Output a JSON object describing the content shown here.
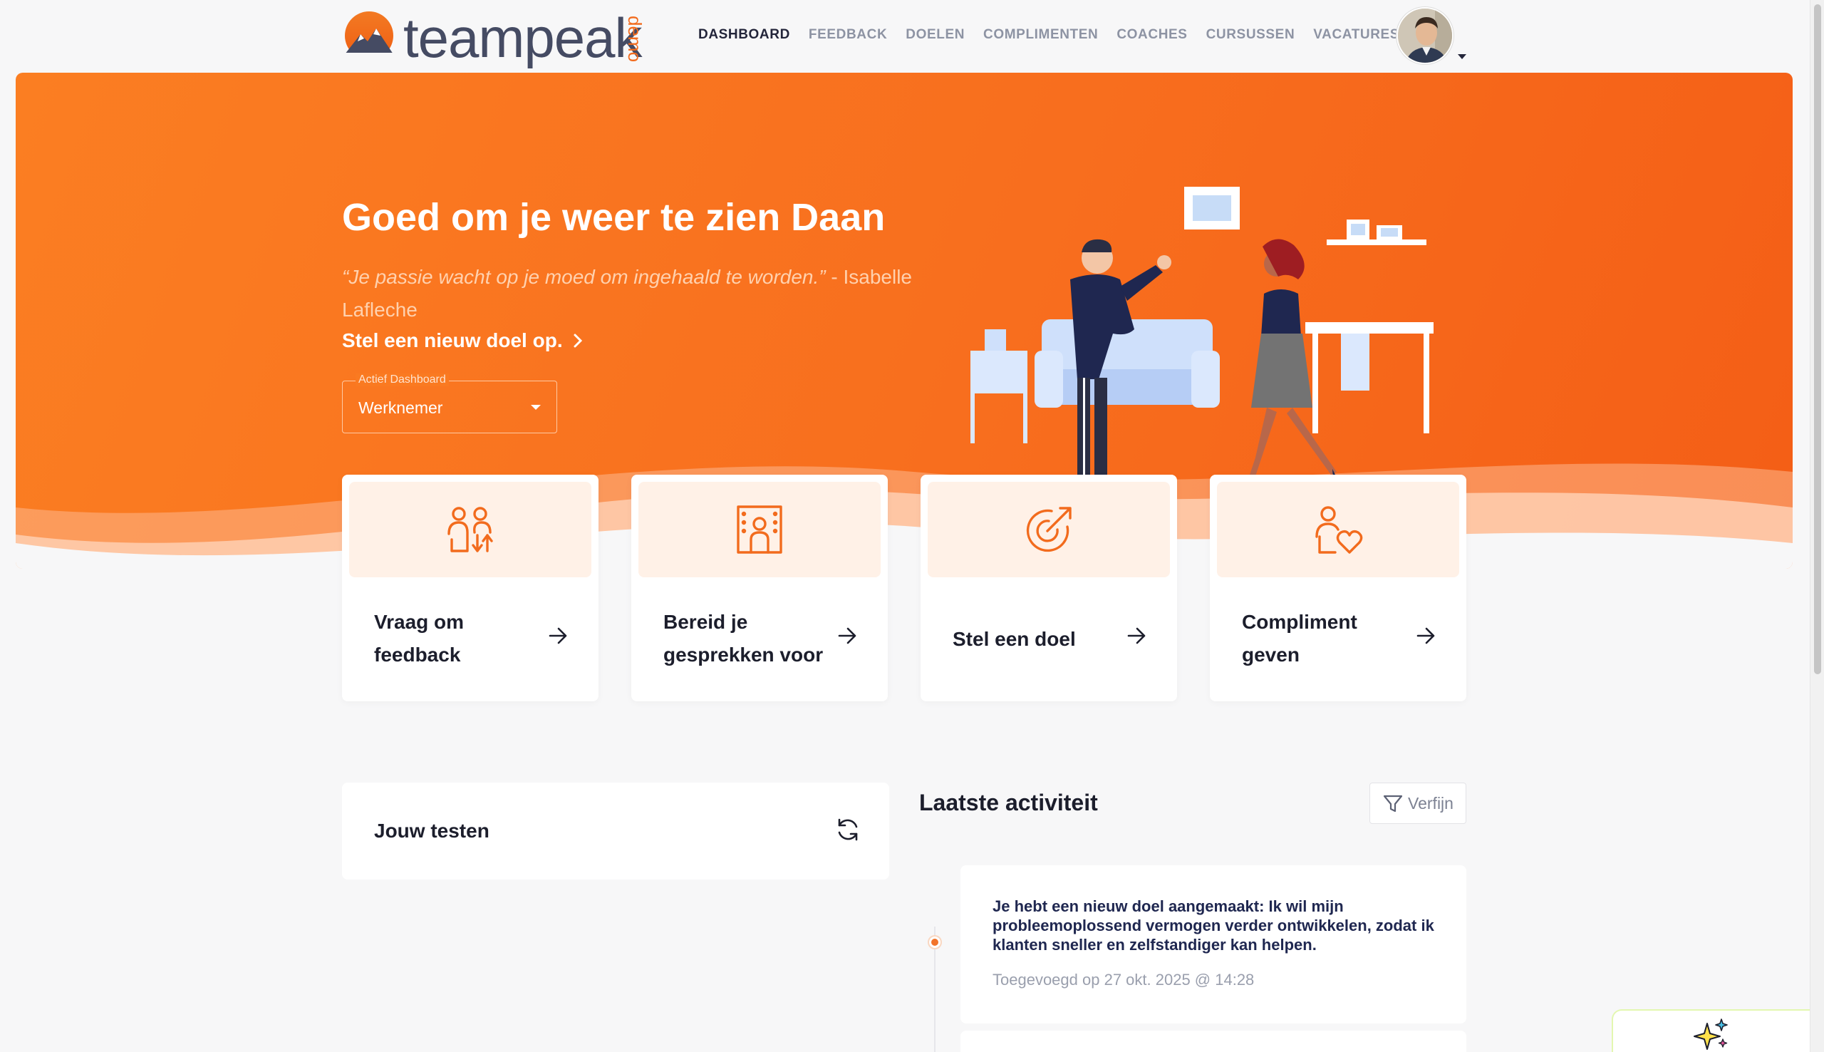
{
  "brand": {
    "name": "teampeak",
    "badge": "demo",
    "accent": "#f26b1d"
  },
  "nav": {
    "items": [
      {
        "label": "DASHBOARD",
        "active": true
      },
      {
        "label": "FEEDBACK",
        "active": false
      },
      {
        "label": "DOELEN",
        "active": false
      },
      {
        "label": "COMPLIMENTEN",
        "active": false
      },
      {
        "label": "COACHES",
        "active": false
      },
      {
        "label": "CURSUSSEN",
        "active": false
      },
      {
        "label": "VACATURES",
        "active": false
      }
    ]
  },
  "hero": {
    "title": "Goed om je weer te zien Daan",
    "quote": "“Je passie wacht op je moed om ingehaald te worden.”",
    "quote_author": "- Isabelle Lafleche",
    "cta": "Stel een nieuw doel op.",
    "dashboard_select": {
      "label": "Actief Dashboard",
      "value": "Werknemer"
    }
  },
  "actions": [
    {
      "label": "Vraag om feedback",
      "icon": "feedback-people-icon"
    },
    {
      "label": "Bereid je gesprekken voor",
      "icon": "door-person-icon"
    },
    {
      "label": "Stel een doel",
      "icon": "target-arrow-icon"
    },
    {
      "label": "Compliment geven",
      "icon": "person-heart-icon"
    }
  ],
  "tests": {
    "title": "Jouw testen"
  },
  "activity": {
    "title": "Laatste activiteit",
    "filter_label": "Verfijn",
    "items": [
      {
        "text": "Je hebt een nieuw doel aangemaakt: Ik wil mijn probleemoplossend vermogen verder ontwikkelen, zodat ik klanten sneller en zelfstandiger kan helpen.",
        "meta": "Toegevoegd op 27 okt. 2025 @ 14:28"
      }
    ]
  }
}
